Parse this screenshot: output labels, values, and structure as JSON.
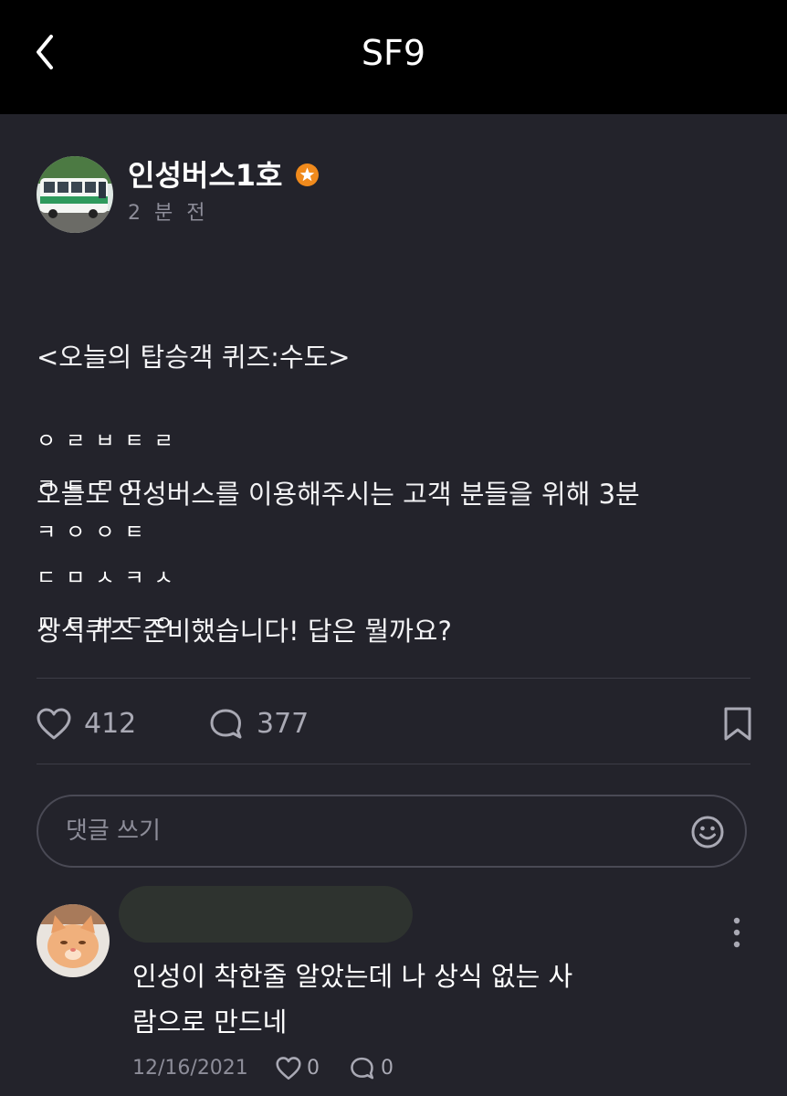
{
  "header": {
    "title": "SF9",
    "back_icon": "chevron-left-icon"
  },
  "post": {
    "author": "인성버스1호",
    "badge_icon": "star-badge-icon",
    "badge_color": "#f08a1c",
    "time": "2 분 전",
    "body_lines": [
      "<오늘의 탑승객 퀴즈:수도>",
      "오늘도 인성버스를 이용해주시는 고객 분들을 위해 3분",
      "상식퀴즈 준비했습니다! 답은 뭘까요?"
    ],
    "quiz_lines": [
      "ㅇㄹㅂㅌㄹ",
      "ㅋㅌㅁㄷ",
      "ㅋㅇㅇㅌ",
      "ㄷㅁㅅㅋㅅ",
      "ㅁㅌㅂㄷㅇ"
    ],
    "likes": "412",
    "comments": "377"
  },
  "comment_input": {
    "placeholder": "댓글 쓰기",
    "emoji_icon": "smiley-icon"
  },
  "comments": [
    {
      "text_lines": [
        "인성이 착한줄 알았는데 나 상식 없는 사",
        "람으로 만드네"
      ],
      "date": "12/16/2021",
      "likes": "0",
      "replies": "0"
    }
  ]
}
